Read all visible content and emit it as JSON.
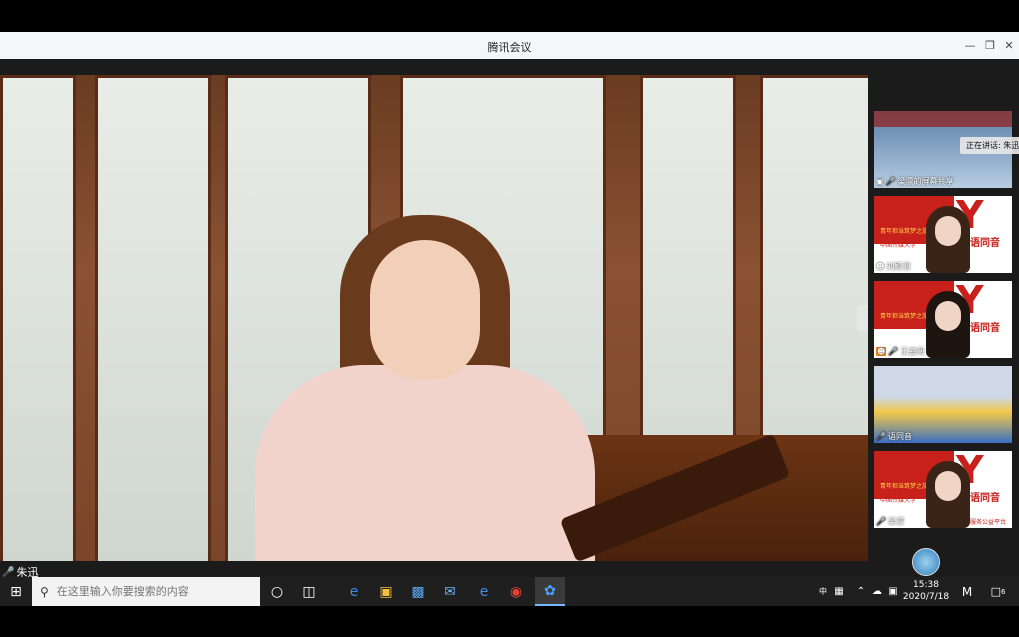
{
  "window": {
    "title": "腾讯会议"
  },
  "main_video": {
    "speaker_name": "朱迅"
  },
  "speaking_tip": "正在讲话: 朱迅",
  "participants": [
    {
      "label": "梁漂的屏幕共享",
      "icon": "share-screen-icon"
    },
    {
      "label": "刘殿羽",
      "icon": "host-icon"
    },
    {
      "label": "王姿阅",
      "icon": "host-icon"
    },
    {
      "label": "语同音",
      "icon": "mic-icon"
    },
    {
      "label": "梁漂",
      "icon": "mic-icon"
    }
  ],
  "banner": {
    "logo_text": "语同音",
    "slogan": "青年担当筑梦之旅",
    "school": "中国传媒大学",
    "platform": "服务公益平台"
  },
  "taskbar": {
    "search_placeholder": "在这里输入你要搜索的内容",
    "time": "15:38",
    "date": "2020/7/18",
    "ime": "中",
    "notifications_count": "6"
  },
  "colors": {
    "accent_red": "#c8201a",
    "taskbar": "#1f1f1f",
    "titlebar": "#f5f6f7"
  }
}
